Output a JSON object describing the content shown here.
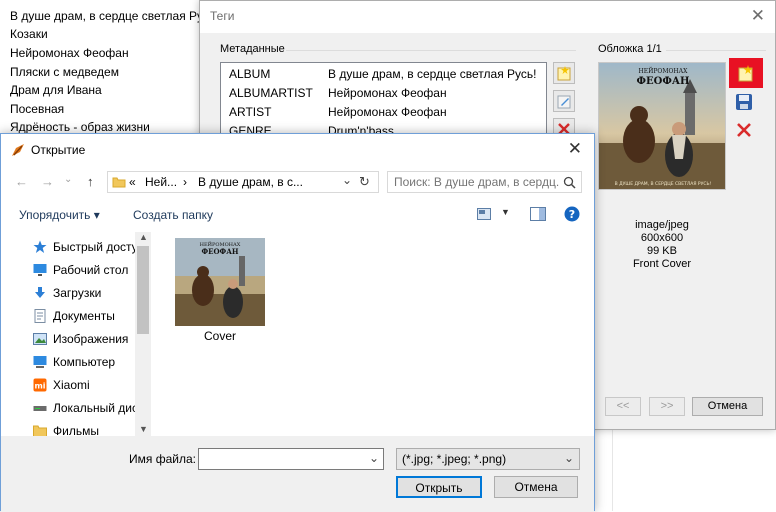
{
  "playlist": {
    "items": [
      "В душе драм, в сердце светлая Русь!",
      "Козаки",
      "Нейромонах Феофан",
      "Пляски с медведем",
      "Драм для Ивана",
      "Посевная",
      "Ядрёность - образ жизни"
    ]
  },
  "tags_dialog": {
    "title": "Теги",
    "metadata_label": "Метаданные",
    "cover_label": "Обложка 1/1",
    "rows": [
      {
        "key": "ALBUM",
        "value": "В душе драм, в сердце светлая Русь!"
      },
      {
        "key": "ALBUMARTIST",
        "value": "Нейромонах Феофан"
      },
      {
        "key": "ARTIST",
        "value": "Нейромонах Феофан"
      },
      {
        "key": "GENRE",
        "value": "Drum'n'bass"
      }
    ],
    "cover_art_text": {
      "top": "НЕЙРОМОНАХ",
      "name": "ФЕОФАН",
      "bottom": "В ДУШЕ ДРАМ, В СЕРДЦЕ СВЕТЛАЯ РУСЬ!"
    },
    "cover_info": {
      "mime": "image/jpeg",
      "size": "600x600",
      "filesize": "99 KB",
      "type": "Front Cover"
    },
    "prev_label": "<<",
    "next_label": ">>",
    "cancel_label": "Отмена"
  },
  "open_dialog": {
    "title": "Открытие",
    "address": {
      "prefix": "«",
      "seg1": "Ней...",
      "sep": "›",
      "seg2": "В душе драм, в с..."
    },
    "search_placeholder": "Поиск: В душе драм, в сердц...",
    "organize_label": "Упорядочить ▾",
    "new_folder_label": "Создать папку",
    "nav_items": [
      {
        "label": "Быстрый доступ",
        "icon": "star-icon",
        "pinned": false
      },
      {
        "label": "Рабочий стол",
        "icon": "desktop-icon",
        "pinned": true
      },
      {
        "label": "Загрузки",
        "icon": "download-icon",
        "pinned": true
      },
      {
        "label": "Документы",
        "icon": "documents-icon",
        "pinned": true
      },
      {
        "label": "Изображения",
        "icon": "pictures-icon",
        "pinned": true
      },
      {
        "label": "Компьютер",
        "icon": "computer-icon",
        "pinned": true
      },
      {
        "label": "Xiaomi",
        "icon": "xiaomi-icon",
        "pinned": false
      },
      {
        "label": "Локальный диск",
        "icon": "drive-icon",
        "pinned": false
      },
      {
        "label": "Фильмы",
        "icon": "folder-icon",
        "pinned": false
      }
    ],
    "pin_glyph": "📌",
    "file": {
      "name": "Cover"
    },
    "filename_label": "Имя файла:",
    "filename_value": "",
    "filter_value": "(*.jpg; *.jpeg; *.png)",
    "open_label": "Открыть",
    "cancel_label": "Отмена"
  },
  "colors": {
    "accent_red": "#e81123",
    "link_blue": "#1e395b",
    "help_blue": "#1565c0"
  }
}
